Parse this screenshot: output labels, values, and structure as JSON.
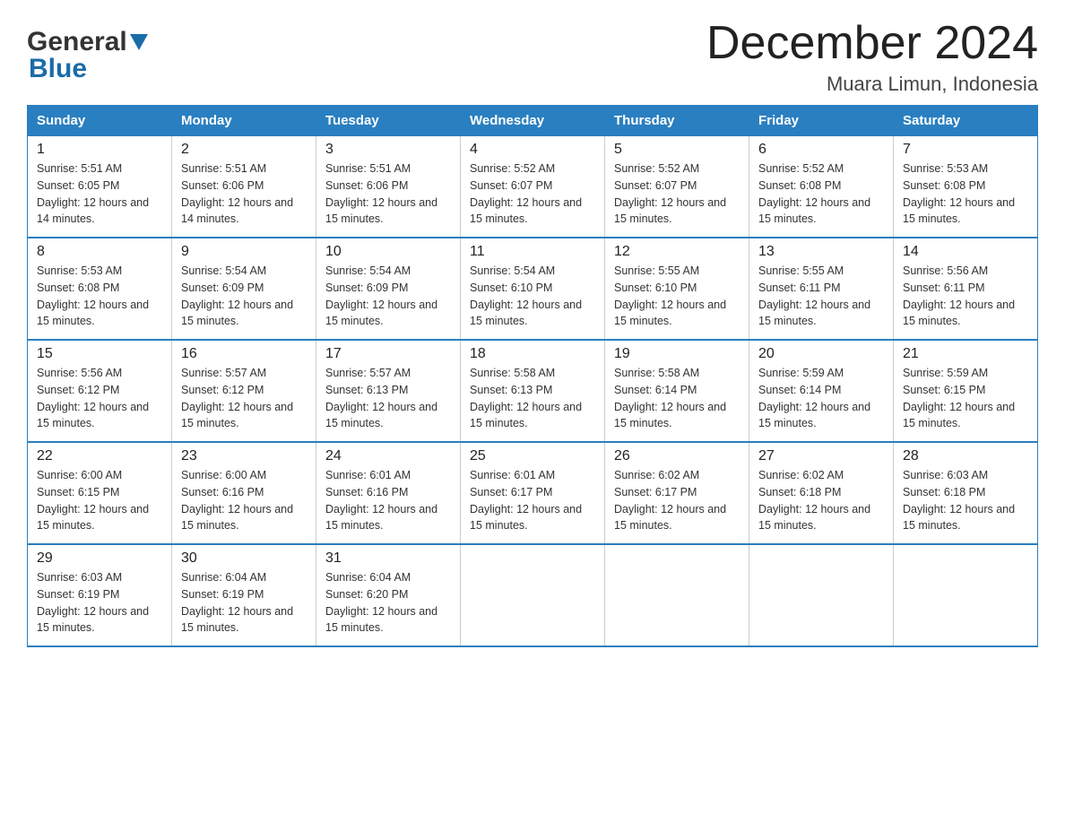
{
  "logo": {
    "general": "General",
    "blue": "Blue",
    "arrow": "▶"
  },
  "title": "December 2024",
  "subtitle": "Muara Limun, Indonesia",
  "days": [
    "Sunday",
    "Monday",
    "Tuesday",
    "Wednesday",
    "Thursday",
    "Friday",
    "Saturday"
  ],
  "weeks": [
    [
      {
        "num": "1",
        "sunrise": "5:51 AM",
        "sunset": "6:05 PM",
        "daylight": "12 hours and 14 minutes."
      },
      {
        "num": "2",
        "sunrise": "5:51 AM",
        "sunset": "6:06 PM",
        "daylight": "12 hours and 14 minutes."
      },
      {
        "num": "3",
        "sunrise": "5:51 AM",
        "sunset": "6:06 PM",
        "daylight": "12 hours and 15 minutes."
      },
      {
        "num": "4",
        "sunrise": "5:52 AM",
        "sunset": "6:07 PM",
        "daylight": "12 hours and 15 minutes."
      },
      {
        "num": "5",
        "sunrise": "5:52 AM",
        "sunset": "6:07 PM",
        "daylight": "12 hours and 15 minutes."
      },
      {
        "num": "6",
        "sunrise": "5:52 AM",
        "sunset": "6:08 PM",
        "daylight": "12 hours and 15 minutes."
      },
      {
        "num": "7",
        "sunrise": "5:53 AM",
        "sunset": "6:08 PM",
        "daylight": "12 hours and 15 minutes."
      }
    ],
    [
      {
        "num": "8",
        "sunrise": "5:53 AM",
        "sunset": "6:08 PM",
        "daylight": "12 hours and 15 minutes."
      },
      {
        "num": "9",
        "sunrise": "5:54 AM",
        "sunset": "6:09 PM",
        "daylight": "12 hours and 15 minutes."
      },
      {
        "num": "10",
        "sunrise": "5:54 AM",
        "sunset": "6:09 PM",
        "daylight": "12 hours and 15 minutes."
      },
      {
        "num": "11",
        "sunrise": "5:54 AM",
        "sunset": "6:10 PM",
        "daylight": "12 hours and 15 minutes."
      },
      {
        "num": "12",
        "sunrise": "5:55 AM",
        "sunset": "6:10 PM",
        "daylight": "12 hours and 15 minutes."
      },
      {
        "num": "13",
        "sunrise": "5:55 AM",
        "sunset": "6:11 PM",
        "daylight": "12 hours and 15 minutes."
      },
      {
        "num": "14",
        "sunrise": "5:56 AM",
        "sunset": "6:11 PM",
        "daylight": "12 hours and 15 minutes."
      }
    ],
    [
      {
        "num": "15",
        "sunrise": "5:56 AM",
        "sunset": "6:12 PM",
        "daylight": "12 hours and 15 minutes."
      },
      {
        "num": "16",
        "sunrise": "5:57 AM",
        "sunset": "6:12 PM",
        "daylight": "12 hours and 15 minutes."
      },
      {
        "num": "17",
        "sunrise": "5:57 AM",
        "sunset": "6:13 PM",
        "daylight": "12 hours and 15 minutes."
      },
      {
        "num": "18",
        "sunrise": "5:58 AM",
        "sunset": "6:13 PM",
        "daylight": "12 hours and 15 minutes."
      },
      {
        "num": "19",
        "sunrise": "5:58 AM",
        "sunset": "6:14 PM",
        "daylight": "12 hours and 15 minutes."
      },
      {
        "num": "20",
        "sunrise": "5:59 AM",
        "sunset": "6:14 PM",
        "daylight": "12 hours and 15 minutes."
      },
      {
        "num": "21",
        "sunrise": "5:59 AM",
        "sunset": "6:15 PM",
        "daylight": "12 hours and 15 minutes."
      }
    ],
    [
      {
        "num": "22",
        "sunrise": "6:00 AM",
        "sunset": "6:15 PM",
        "daylight": "12 hours and 15 minutes."
      },
      {
        "num": "23",
        "sunrise": "6:00 AM",
        "sunset": "6:16 PM",
        "daylight": "12 hours and 15 minutes."
      },
      {
        "num": "24",
        "sunrise": "6:01 AM",
        "sunset": "6:16 PM",
        "daylight": "12 hours and 15 minutes."
      },
      {
        "num": "25",
        "sunrise": "6:01 AM",
        "sunset": "6:17 PM",
        "daylight": "12 hours and 15 minutes."
      },
      {
        "num": "26",
        "sunrise": "6:02 AM",
        "sunset": "6:17 PM",
        "daylight": "12 hours and 15 minutes."
      },
      {
        "num": "27",
        "sunrise": "6:02 AM",
        "sunset": "6:18 PM",
        "daylight": "12 hours and 15 minutes."
      },
      {
        "num": "28",
        "sunrise": "6:03 AM",
        "sunset": "6:18 PM",
        "daylight": "12 hours and 15 minutes."
      }
    ],
    [
      {
        "num": "29",
        "sunrise": "6:03 AM",
        "sunset": "6:19 PM",
        "daylight": "12 hours and 15 minutes."
      },
      {
        "num": "30",
        "sunrise": "6:04 AM",
        "sunset": "6:19 PM",
        "daylight": "12 hours and 15 minutes."
      },
      {
        "num": "31",
        "sunrise": "6:04 AM",
        "sunset": "6:20 PM",
        "daylight": "12 hours and 15 minutes."
      },
      null,
      null,
      null,
      null
    ]
  ]
}
